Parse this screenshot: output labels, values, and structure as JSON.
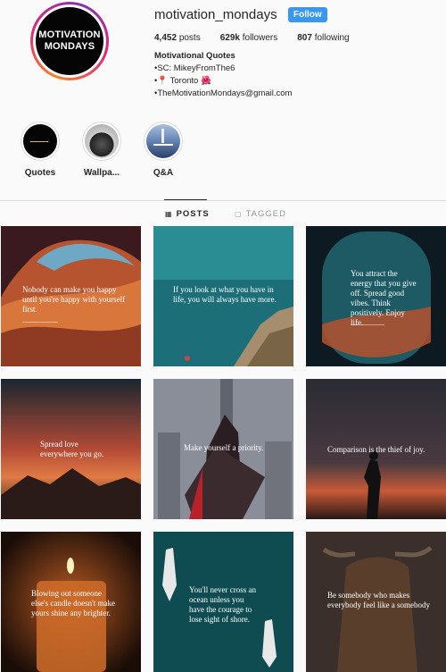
{
  "profile": {
    "avatar_text_line1": "MOTIVATION",
    "avatar_text_line2": "MONDAYS",
    "username": "motivation_mondays",
    "follow_label": "Follow",
    "stats": {
      "posts_count": "4,452",
      "posts_label": "posts",
      "followers_count": "629k",
      "followers_label": "followers",
      "following_count": "807",
      "following_label": "following"
    },
    "bio": {
      "name": "Motivational Quotes",
      "line1": "•SC: MikeyFromThe6",
      "line2": "•📍 Toronto 🌺",
      "line3": "•TheMotivationMondays@gmail.com"
    }
  },
  "highlights": [
    {
      "label": "Quotes"
    },
    {
      "label": "Wallpa..."
    },
    {
      "label": "Q&A"
    }
  ],
  "tabs": {
    "posts_label": "POSTS",
    "tagged_label": "TAGGED"
  },
  "posts": [
    {
      "quote": "Nobody can make you happy until you're happy with yourself first."
    },
    {
      "quote": "If you look at what you have in life, you will always have more."
    },
    {
      "quote": "You attract the energy that you give off. Spread good vibes. Think positively. Enjoy life."
    },
    {
      "quote": "Spread love everywhere you go."
    },
    {
      "quote": "Make yourself a priority."
    },
    {
      "quote": "Comparison is the thief of joy."
    },
    {
      "quote": "Blowing out someone else's candle doesn't make yours shine any brighter."
    },
    {
      "quote": "You'll never cross an ocean unless you have the courage to lose sight of shore."
    },
    {
      "quote": "Be somebody who makes everybody feel like a somebody"
    }
  ]
}
